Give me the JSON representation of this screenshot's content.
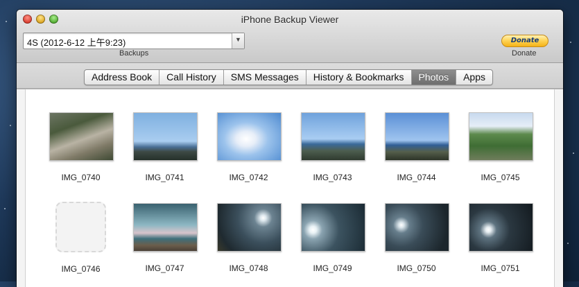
{
  "window": {
    "title": "iPhone Backup Viewer"
  },
  "backups": {
    "selected": "4S (2012-6-12 上午9:23)",
    "label": "Backups"
  },
  "donate": {
    "button_label": "Donate",
    "label": "Donate"
  },
  "tabs": [
    {
      "label": "Address Book",
      "active": false
    },
    {
      "label": "Call History",
      "active": false
    },
    {
      "label": "SMS Messages",
      "active": false
    },
    {
      "label": "History & Bookmarks",
      "active": false
    },
    {
      "label": "Photos",
      "active": true
    },
    {
      "label": "Apps",
      "active": false
    }
  ],
  "photos": {
    "row1": [
      "IMG_0740",
      "IMG_0741",
      "IMG_0742",
      "IMG_0743",
      "IMG_0744",
      "IMG_0745"
    ],
    "row2": [
      "IMG_0746",
      "IMG_0747",
      "IMG_0748",
      "IMG_0749",
      "IMG_0750",
      "IMG_0751"
    ],
    "placeholder": "IMG_0746"
  },
  "icons": {
    "close": "close-light",
    "minimize": "minimize-light",
    "zoom": "zoom-light",
    "dropdown": "chevron-down-icon"
  }
}
